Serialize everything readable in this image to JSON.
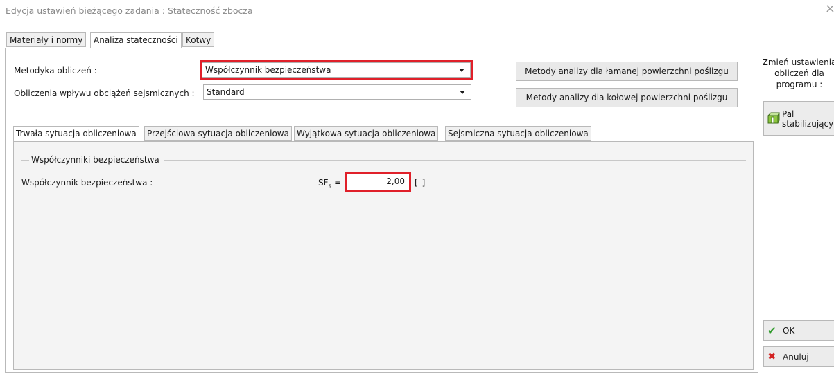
{
  "window": {
    "title": "Edycja ustawień bieżącego zadania : Stateczność zbocza",
    "close_glyph": "×"
  },
  "top_tabs": [
    {
      "label": "Materiały i normy",
      "active": false
    },
    {
      "label": "Analiza stateczności",
      "active": true
    },
    {
      "label": "Kotwy",
      "active": false
    }
  ],
  "form": {
    "method_label": "Metodyka obliczeń :",
    "method_value": "Współczynnik bezpieczeństwa",
    "seismic_label": "Obliczenia wpływu obciążeń sejsmicznych :",
    "seismic_value": "Standard",
    "btn_broken": "Metody analizy dla łamanej powierzchni poślizgu",
    "btn_circular": "Metody analizy dla kołowej powierzchni poślizgu"
  },
  "inner_tabs": [
    {
      "label": "Trwała sytuacja obliczeniowa",
      "active": true
    },
    {
      "label": "Przejściowa sytuacja obliczeniowa",
      "active": false
    },
    {
      "label": "Wyjątkowa sytuacja obliczeniowa",
      "active": false
    },
    {
      "label": "Sejsmiczna sytuacja obliczeniowa",
      "active": false
    }
  ],
  "factors": {
    "group_title": "Współczynniki bezpieczeństwa",
    "sf_label": "Współczynnik bezpieczeństwa :",
    "sf_symbol": "SF",
    "sf_subscript": "s",
    "sf_equals": "=",
    "sf_value": "2,00",
    "sf_unit": "[–]"
  },
  "right_panel": {
    "change_title": "Zmień ustawienia obliczeń dla programu :",
    "pile_button_line1": "Pal",
    "pile_button_line2": "stabilizujący",
    "pile_icon": "pile-icon",
    "ok_label": "OK",
    "ok_icon": "check-icon",
    "cancel_label": "Anuluj",
    "cancel_icon": "x-icon"
  },
  "colors": {
    "highlight": "#e0202a",
    "ok_green": "#2e9a2a",
    "cancel_red": "#d32323"
  }
}
